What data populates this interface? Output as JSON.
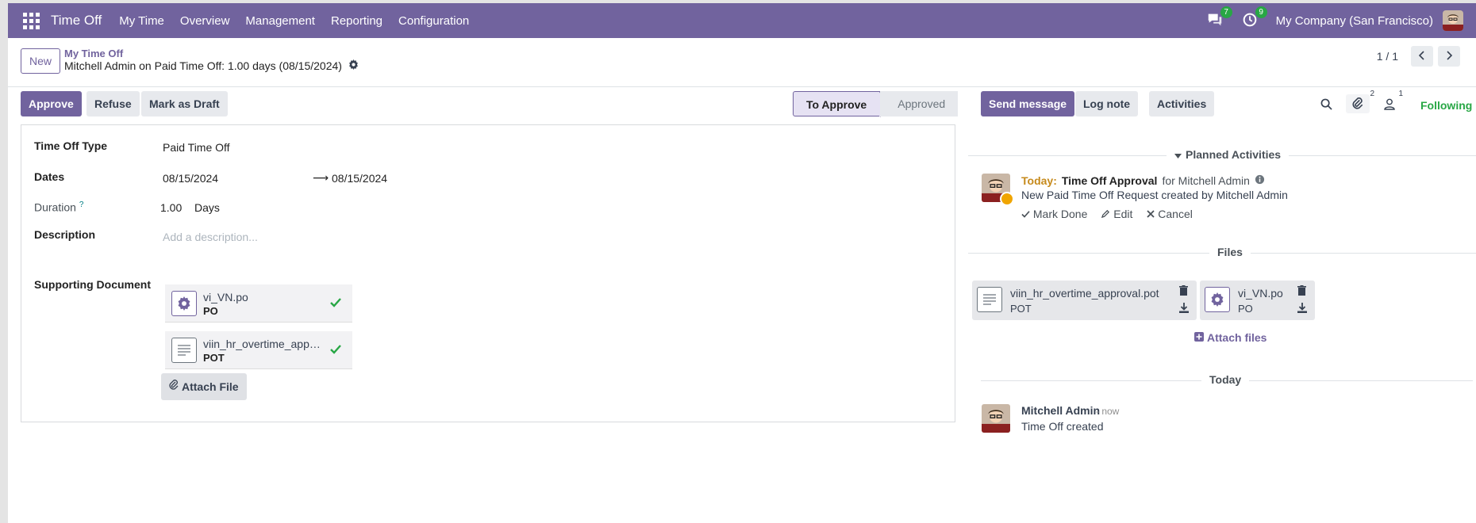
{
  "navbar": {
    "brand": "Time Off",
    "menu": [
      "My Time",
      "Overview",
      "Management",
      "Reporting",
      "Configuration"
    ],
    "messages_count": "7",
    "activities_count": "9",
    "company": "My Company (San Francisco)"
  },
  "control": {
    "new_label": "New",
    "breadcrumb": "My Time Off",
    "record_title": "Mitchell Admin on Paid Time Off: 1.00 days (08/15/2024)",
    "pager": "1 / 1"
  },
  "actions": {
    "approve": "Approve",
    "refuse": "Refuse",
    "mark_draft": "Mark as Draft"
  },
  "status": {
    "active": "To Approve",
    "next": "Approved"
  },
  "form": {
    "type_label": "Time Off Type",
    "type_value": "Paid Time Off",
    "dates_label": "Dates",
    "date_from": "08/15/2024",
    "date_to": "08/15/2024",
    "date_arrow": "⟶",
    "duration_label": "Duration",
    "duration_help": "?",
    "duration_value": "1.00",
    "duration_unit": "Days",
    "description_label": "Description",
    "description_placeholder": "Add a description...",
    "supporting_label": "Supporting Document",
    "attachments": [
      {
        "name": "vi_VN.po",
        "ext": "PO"
      },
      {
        "name": "viin_hr_overtime_approval.pot",
        "ext": "POT"
      }
    ],
    "attach_label": "Attach File"
  },
  "chatter": {
    "send_message": "Send message",
    "log_note": "Log note",
    "activities": "Activities",
    "attachments_count": "2",
    "followers_count": "1",
    "following": "Following",
    "planned_title": "Planned Activities",
    "activity": {
      "today": "Today:",
      "summary": "Time Off Approval",
      "for": "for Mitchell Admin",
      "note": "New Paid Time Off Request created by Mitchell Admin",
      "mark_done": "Mark Done",
      "edit": "Edit",
      "cancel": "Cancel"
    },
    "files_title": "Files",
    "files": [
      {
        "name": "viin_hr_overtime_approval.pot",
        "ext": "POT"
      },
      {
        "name": "vi_VN.po",
        "ext": "PO"
      }
    ],
    "attach_files": "Attach files",
    "today_separator": "Today",
    "message": {
      "author": "Mitchell Admin",
      "date": "- now",
      "body": "Time Off created"
    }
  },
  "colors": {
    "brand": "#71639e",
    "success": "#28a745",
    "warning": "#c68a1c"
  }
}
